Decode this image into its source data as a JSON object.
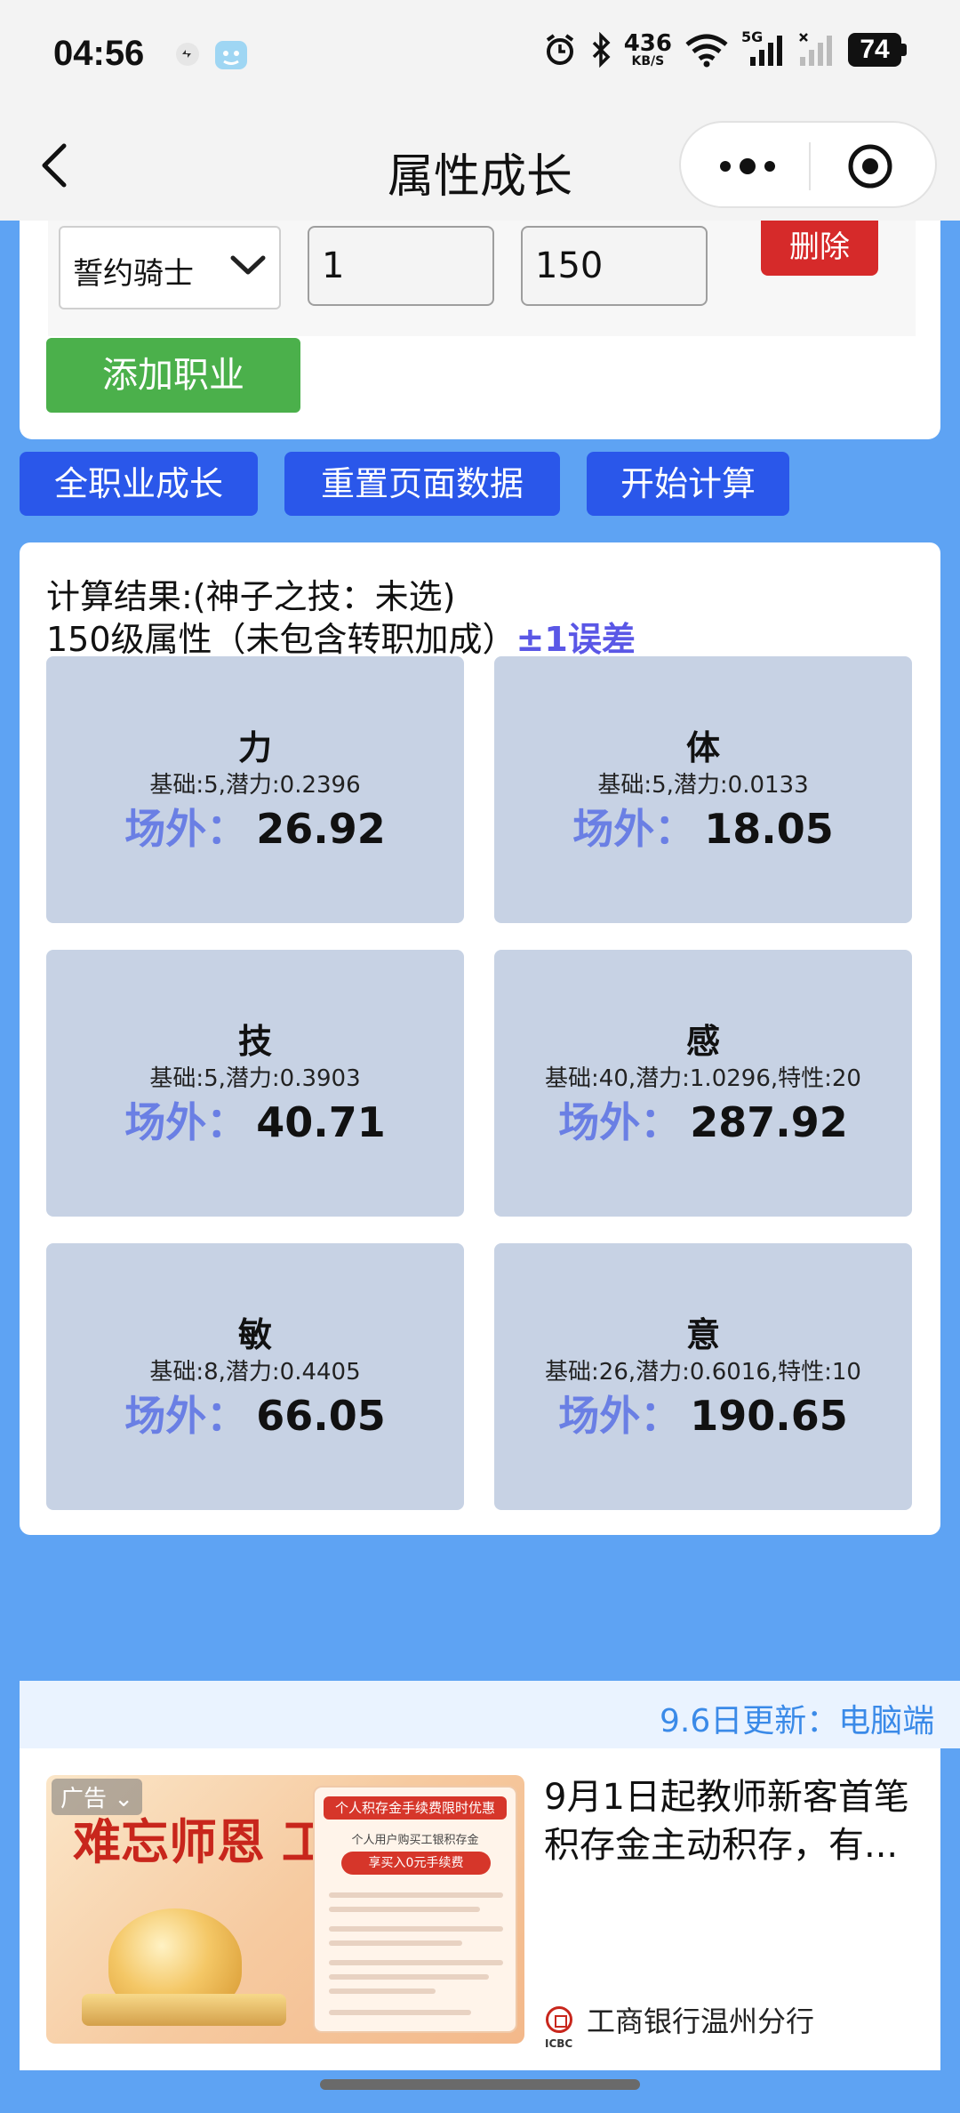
{
  "status_bar": {
    "time": "04:56",
    "net_speed_value": "436",
    "net_speed_unit": "KB/S",
    "network": "5G",
    "battery": "74"
  },
  "title_bar": {
    "title": "属性成长"
  },
  "job_row": {
    "job_select_value": "誓约骑士",
    "start_level": "1",
    "end_level": "150",
    "delete_label": "删除"
  },
  "add_job_label": "添加职业",
  "actions": {
    "all_growth_label": "全职业成长",
    "reset_label": "重置页面数据",
    "start_label": "开始计算"
  },
  "results": {
    "header_line1": "计算结果:(神子之技：未选)",
    "header_line2": "150级属性（未包含转职加成）",
    "error_note": "±1误差",
    "value_label": "场外：",
    "stats": [
      {
        "name": "力",
        "base": "基础:5,潜力:0.2396",
        "value": "26.92"
      },
      {
        "name": "体",
        "base": "基础:5,潜力:0.0133",
        "value": "18.05"
      },
      {
        "name": "技",
        "base": "基础:5,潜力:0.3903",
        "value": "40.71"
      },
      {
        "name": "感",
        "base": "基础:40,潜力:1.0296,特性:20",
        "value": "287.92"
      },
      {
        "name": "敏",
        "base": "基础:8,潜力:0.4405",
        "value": "66.05"
      },
      {
        "name": "意",
        "base": "基础:26,潜力:0.6016,特性:10",
        "value": "190.65"
      }
    ]
  },
  "update_banner": "9.6日更新：电脑端",
  "ad": {
    "tag": "广告",
    "image_headline": "难忘师恩 工行有礼",
    "image_card_title": "个人积存金手续费限时优惠",
    "image_card_sub": "个人用户购买工银积存金",
    "image_card_pill": "享买入0元手续费",
    "title": "9月1日起教师新客首笔积存金主动积存，有...",
    "brand": "工商银行温州分行",
    "brand_logo_text": "ICBC"
  }
}
